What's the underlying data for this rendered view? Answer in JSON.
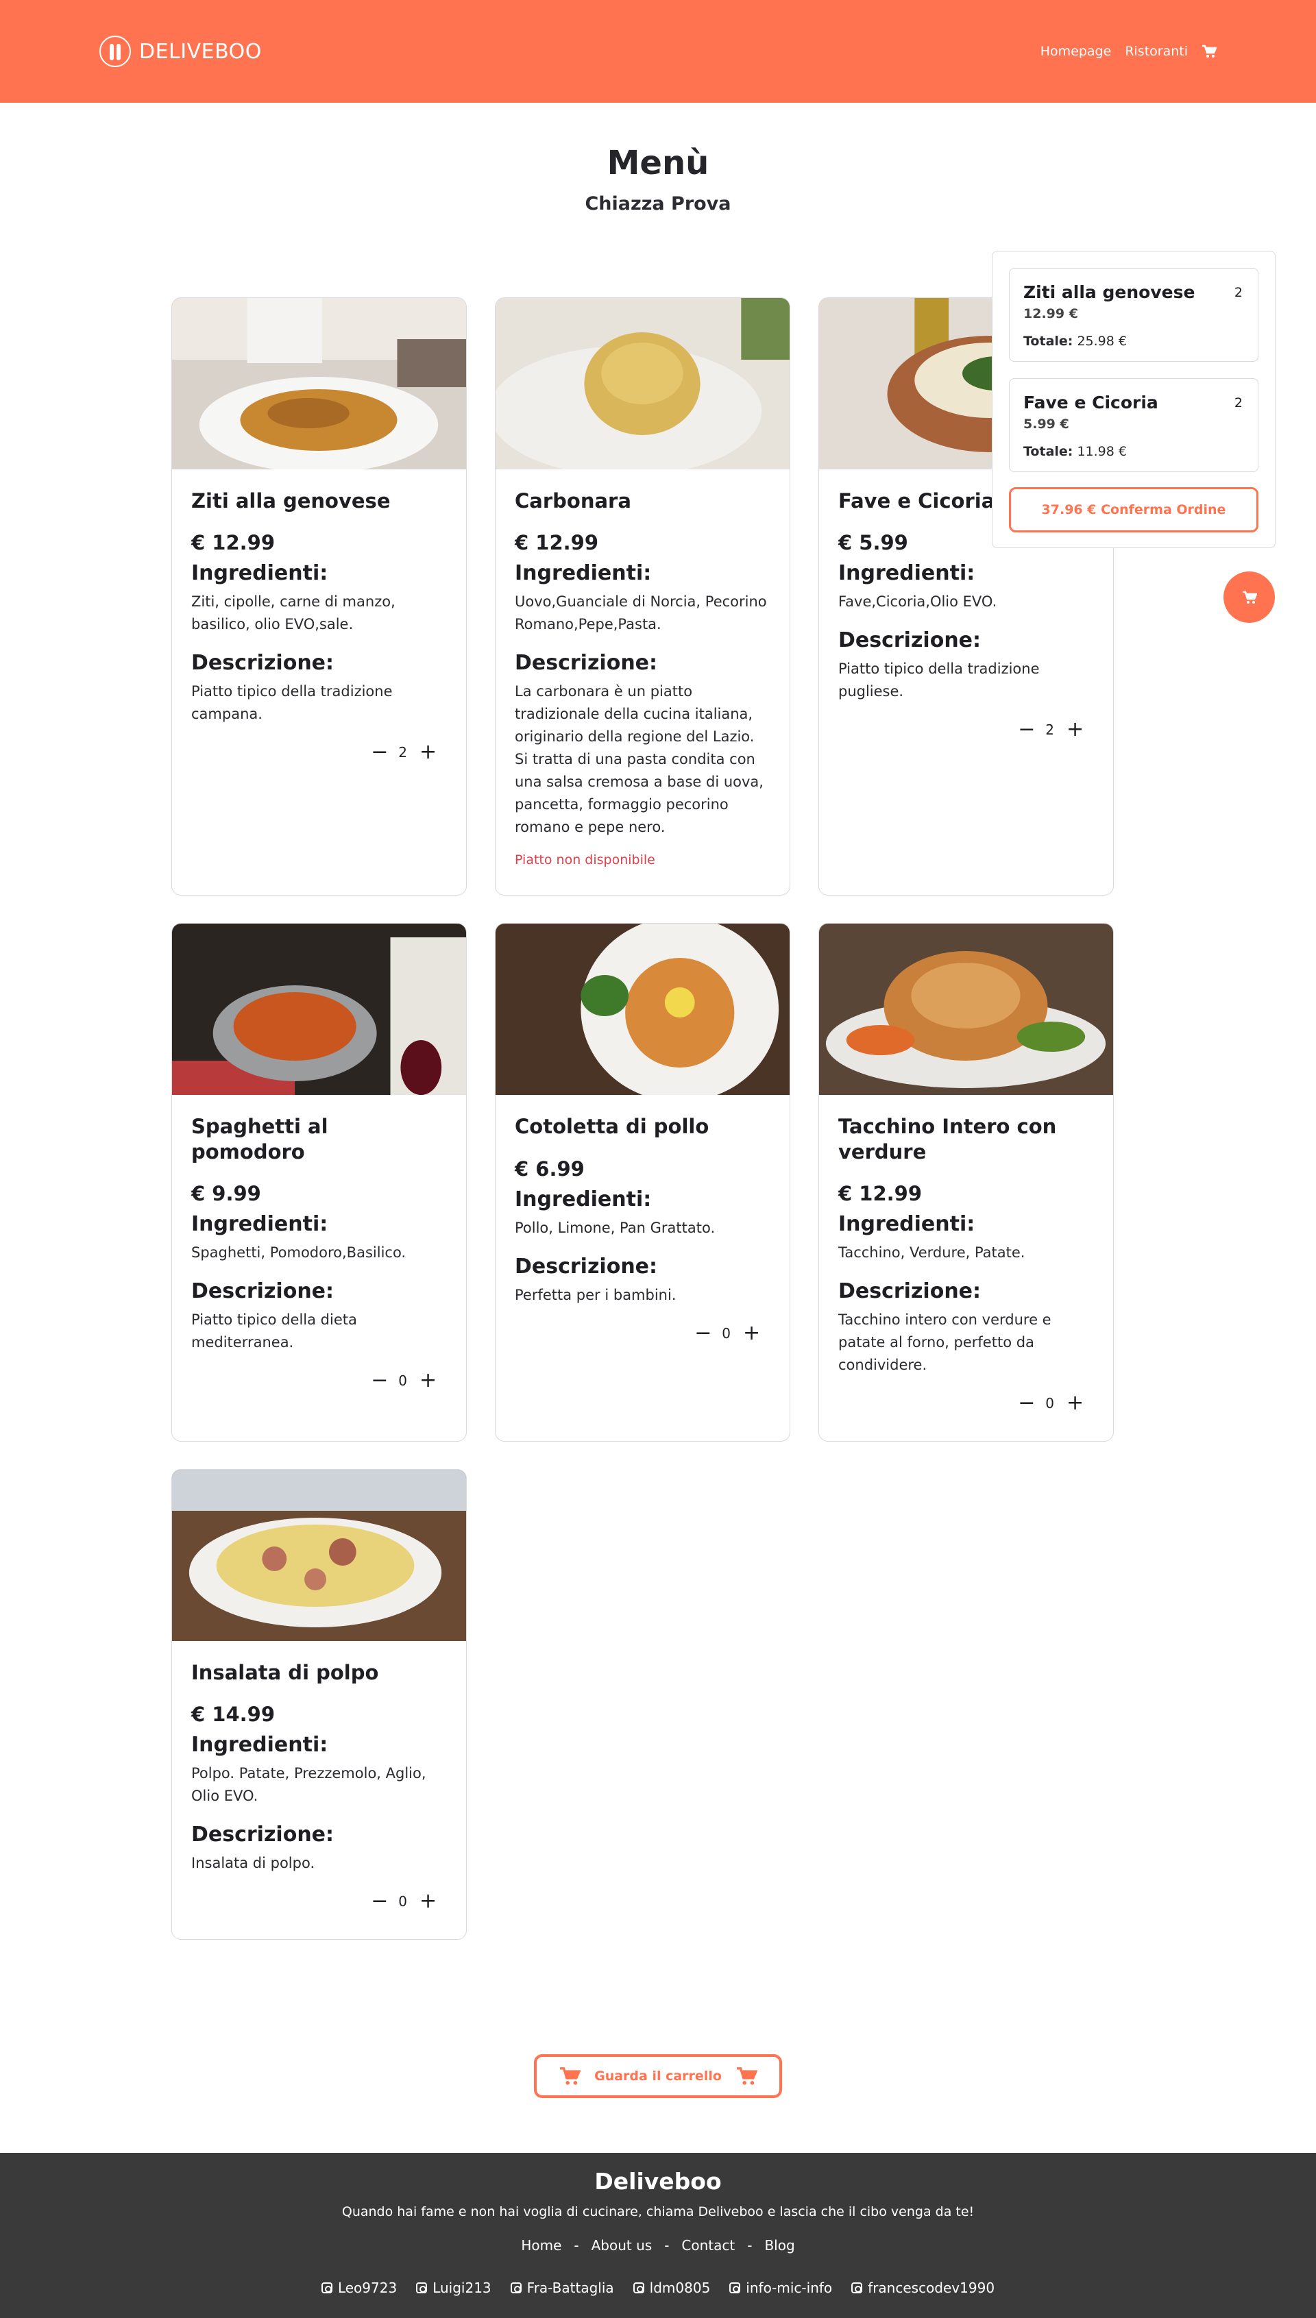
{
  "header": {
    "brand": "DELIVEBOO",
    "nav": [
      "Homepage",
      "Ristoranti"
    ]
  },
  "page": {
    "title": "Menù",
    "restaurant": "Chiazza Prova"
  },
  "labels": {
    "ingredients": "Ingredienti:",
    "description": "Descrizione:",
    "unavailable": "Piatto non disponibile"
  },
  "dishes": [
    {
      "name": "Ziti alla genovese",
      "price": "€ 12.99",
      "ingredients": "Ziti, cipolle, carne di manzo, basilico, olio EVO,sale.",
      "description": "Piatto tipico della tradizione campana.",
      "qty": "2"
    },
    {
      "name": "Carbonara",
      "price": "€ 12.99",
      "ingredients": "Uovo,Guanciale di Norcia, Pecorino Romano,Pepe,Pasta.",
      "description": "La carbonara è un piatto tradizionale della cucina italiana, originario della regione del Lazio. Si tratta di una pasta condita con una salsa cremosa a base di uova, pancetta, formaggio pecorino romano e pepe nero."
    },
    {
      "name": "Fave e Cicoria",
      "price": "€ 5.99",
      "ingredients": "Fave,Cicoria,Olio EVO.",
      "description": "Piatto tipico della tradizione pugliese.",
      "qty": "2"
    },
    {
      "name": "Spaghetti al pomodoro",
      "price": "€ 9.99",
      "ingredients": "Spaghetti, Pomodoro,Basilico.",
      "description": "Piatto tipico della dieta mediterranea.",
      "qty": "0"
    },
    {
      "name": "Cotoletta di pollo",
      "price": "€ 6.99",
      "ingredients": "Pollo, Limone, Pan Grattato.",
      "description": "Perfetta per i bambini.",
      "qty": "0"
    },
    {
      "name": "Tacchino Intero con verdure",
      "price": "€ 12.99",
      "ingredients": "Tacchino, Verdure, Patate.",
      "description": "Tacchino intero con verdure e patate al forno, perfetto da condividere.",
      "qty": "0"
    },
    {
      "name": "Insalata di polpo",
      "price": "€ 14.99",
      "ingredients": "Polpo. Patate, Prezzemolo, Aglio, Olio EVO.",
      "description": "Insalata di polpo.",
      "qty": "0"
    }
  ],
  "cart": {
    "items": [
      {
        "name": "Ziti alla genovese",
        "qty": "2",
        "price": "12.99 €",
        "total_label": "Totale:",
        "total": "25.98 €"
      },
      {
        "name": "Fave e Cicoria",
        "qty": "2",
        "price": "5.99 €",
        "total_label": "Totale:",
        "total": "11.98 €"
      }
    ],
    "confirm_label": "37.96 € Conferma Ordine"
  },
  "view_cart_label": "Guarda il carrello",
  "footer": {
    "title": "Deliveboo",
    "tagline": "Quando hai fame e non hai voglia di cucinare, chiama Deliveboo e lascia che il cibo venga da te!",
    "links": [
      "Home",
      "About us",
      "Contact",
      "Blog"
    ],
    "separator": "-",
    "socials": [
      "Leo9723",
      "Luigi213",
      "Fra-Battaglia",
      "ldm0805",
      "info-mic-info",
      "francescodev1990"
    ]
  },
  "colors": {
    "accent": "#ff7350",
    "footer_bg": "#3a3a3a",
    "error": "#e0404a"
  }
}
